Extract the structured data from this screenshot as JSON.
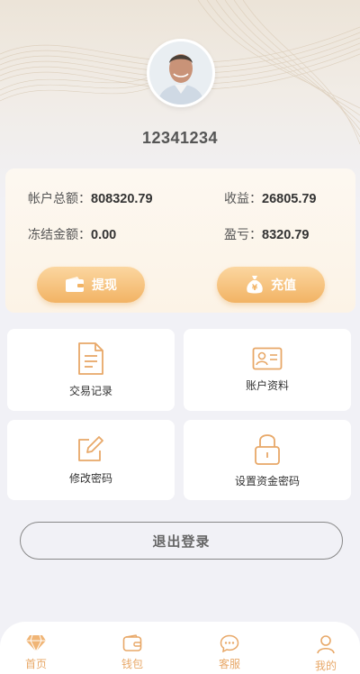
{
  "profile": {
    "username": "12341234"
  },
  "balance": {
    "total_label": "帐户总额：",
    "total_value": "808320.79",
    "income_label": "收益：",
    "income_value": "26805.79",
    "frozen_label": "冻结金额：",
    "frozen_value": "0.00",
    "pnl_label": "盈亏：",
    "pnl_value": "8320.79"
  },
  "actions": {
    "withdraw_label": "提现",
    "recharge_label": "充值"
  },
  "menu": {
    "trade_records": "交易记录",
    "account_info": "账户资料",
    "change_password": "修改密码",
    "fund_password": "设置资金密码"
  },
  "logout_label": "退出登录",
  "tabbar": [
    {
      "label": "首页",
      "icon": "diamond-icon"
    },
    {
      "label": "钱包",
      "icon": "wallet-icon"
    },
    {
      "label": "客服",
      "icon": "chat-icon"
    },
    {
      "label": "我的",
      "icon": "user-icon"
    }
  ],
  "colors": {
    "accent": "#f2b364",
    "tab_active": "#e8a868"
  }
}
